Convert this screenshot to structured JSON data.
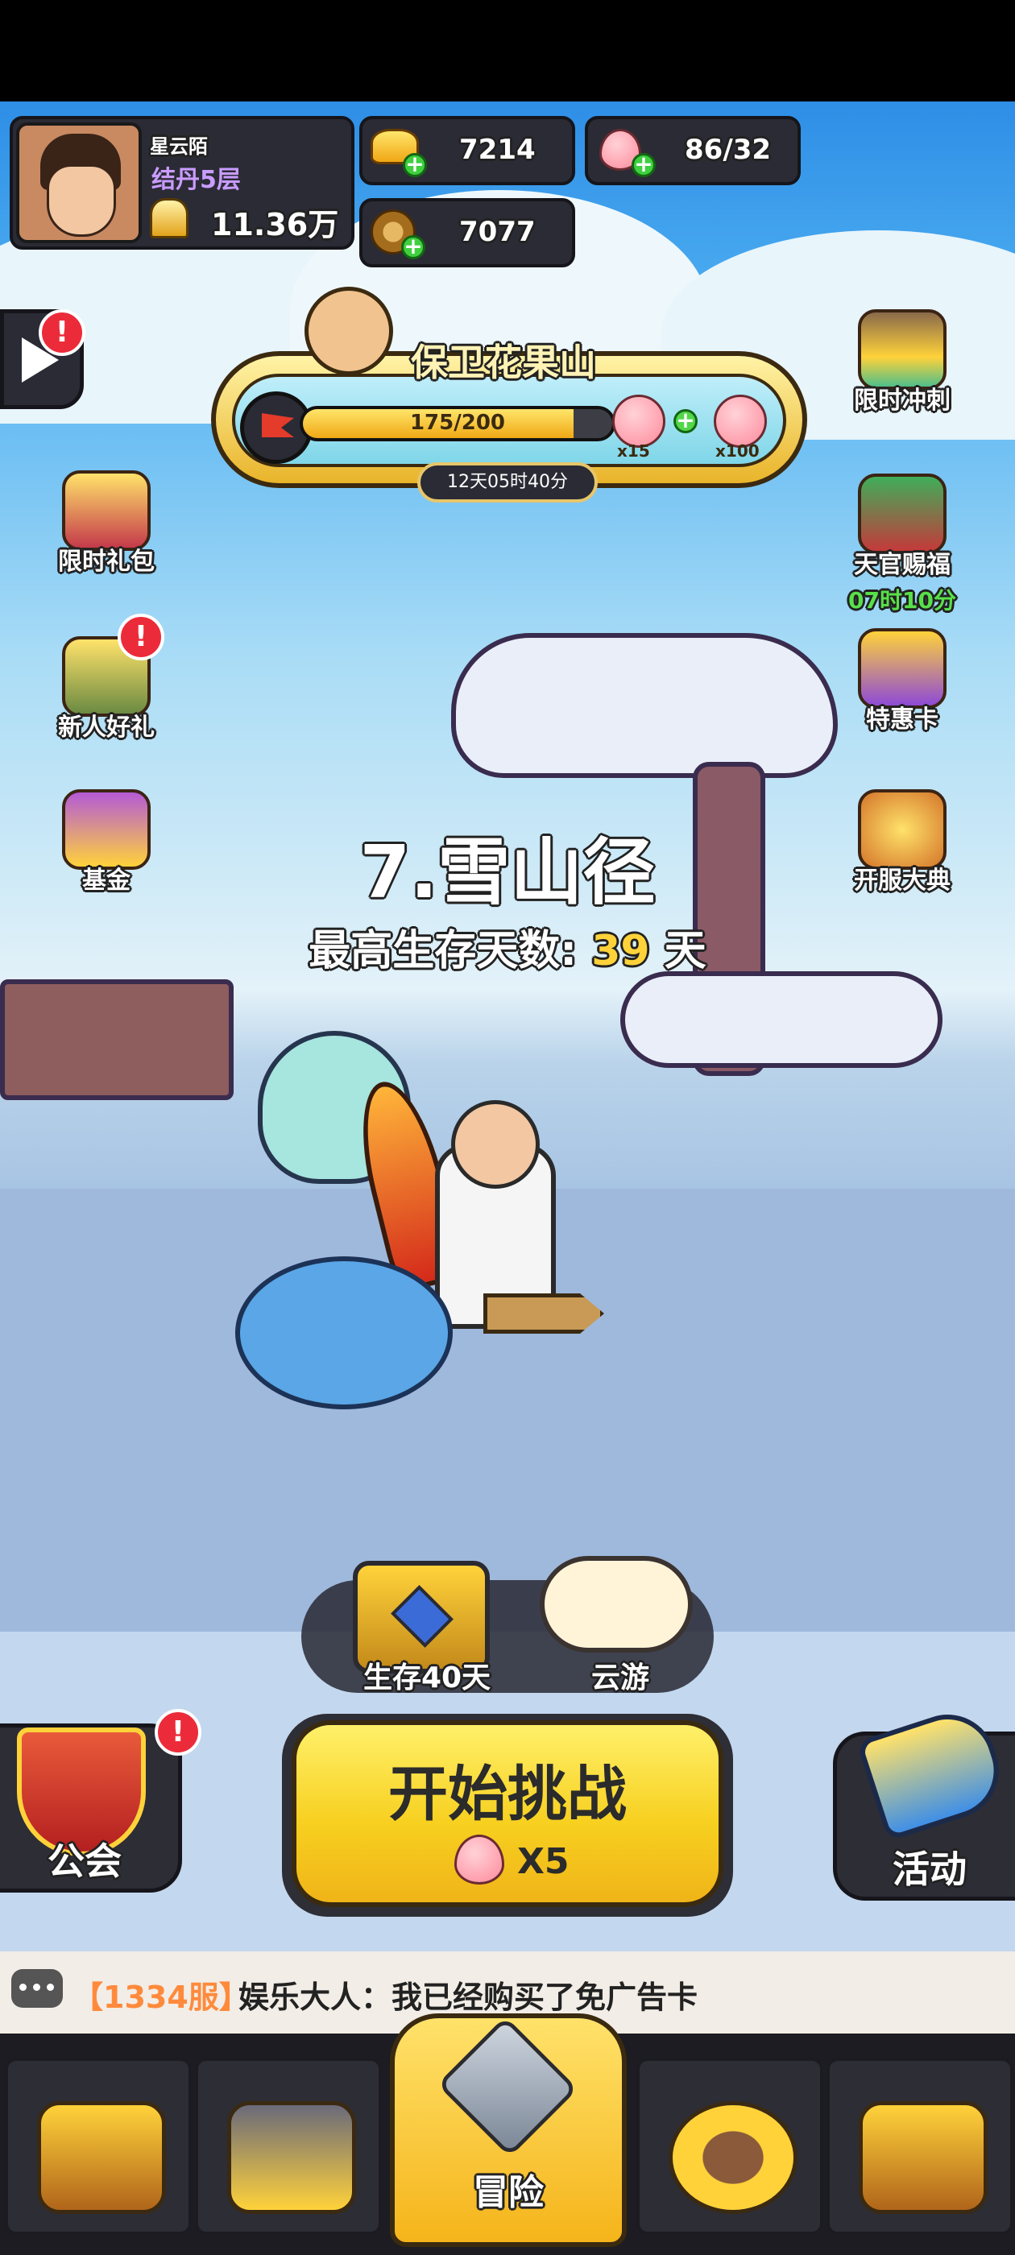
{
  "player": {
    "name": "星云陌",
    "rank": "结丹5层",
    "power": "11.36万"
  },
  "resources": {
    "gold": "7214",
    "copper": "7077",
    "peach": "86/32"
  },
  "event": {
    "title": "保卫花果山",
    "progress_text": "175/200",
    "progress": 0.875,
    "reward1": "x15",
    "reward2": "x100",
    "timer": "12天05时40分"
  },
  "left_icons": [
    {
      "label": "限时礼包"
    },
    {
      "label": "新人好礼"
    },
    {
      "label": "基金"
    }
  ],
  "right_icons": [
    {
      "label": "限时冲刺"
    },
    {
      "label": "天官赐福",
      "timer": "07时10分"
    },
    {
      "label": "特惠卡"
    },
    {
      "label": "开服大典"
    }
  ],
  "stage": {
    "name": "7.雪山径",
    "best_label": "最高生存天数:",
    "best_value": "39",
    "best_unit": "天"
  },
  "quick": {
    "chest_label": "生存40天",
    "cloud_label": "云游"
  },
  "guild_label": "公会",
  "activity_label": "活动",
  "start": {
    "label": "开始挑战",
    "cost": "X5"
  },
  "chat": {
    "server": "【1334服】",
    "message": "娱乐大人：我已经购买了免广告卡"
  },
  "nav": {
    "adventure": "冒险"
  },
  "colors": {
    "accent": "#ffd23a",
    "timer_green": "#58e04a",
    "chat_server": "#ff8a3c",
    "best_value": "#ffd23a"
  },
  "icons": [
    "avatar",
    "gold-ingot-icon",
    "copper-coin-icon",
    "peach-icon",
    "video-icon",
    "chest-icon",
    "cloud-icon",
    "guild-banner-icon",
    "horn-icon",
    "chat-icon",
    "home-icon",
    "helmet-icon",
    "swords-icon",
    "upgrade-icon",
    "treasure-chest-icon"
  ]
}
